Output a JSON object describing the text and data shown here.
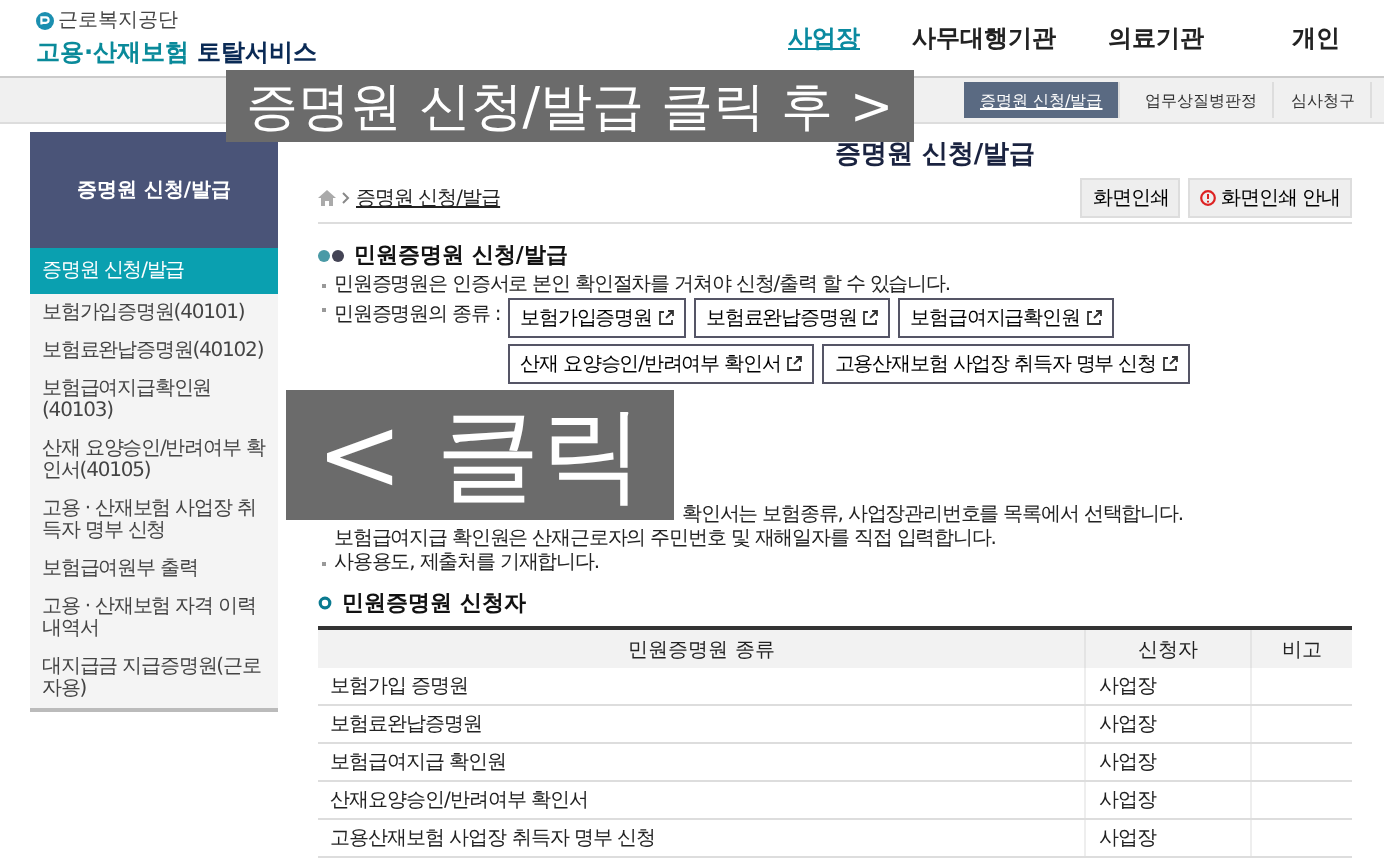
{
  "header": {
    "agency": "근로복지공단",
    "service_prefix": "고용·산재보험",
    "service_suffix": "토탈서비스",
    "nav": [
      {
        "label": "사업장",
        "selected": true
      },
      {
        "label": "사무대행기관",
        "selected": false
      },
      {
        "label": "의료기관",
        "selected": false
      },
      {
        "label": "개인",
        "selected": false
      }
    ]
  },
  "subnav": [
    {
      "label": "증명원 신청/발급",
      "selected": true
    },
    {
      "label": "업무상질병판정",
      "selected": false
    },
    {
      "label": "심사청구",
      "selected": false
    }
  ],
  "sidebar": {
    "title": "증명원 신청/발급",
    "items": [
      {
        "label": "증명원 신청/발급",
        "selected": true
      },
      {
        "label": "보험가입증명원(40101)",
        "selected": false
      },
      {
        "label": "보험료완납증명원(40102)",
        "selected": false
      },
      {
        "label": "보험급여지급확인원(40103)",
        "selected": false
      },
      {
        "label": "산재 요양승인/반려여부 확인서(40105)",
        "selected": false
      },
      {
        "label": "고용 · 산재보험 사업장 취득자 명부 신청",
        "selected": false
      },
      {
        "label": "보험급여원부 출력",
        "selected": false
      },
      {
        "label": "고용 · 산재보험 자격 이력 내역서",
        "selected": false
      },
      {
        "label": "대지급금 지급증명원(근로자용)",
        "selected": false
      }
    ]
  },
  "page_title": "증명원 신청/발급",
  "breadcrumb": "증명원 신청/발급",
  "print_buttons": [
    "화면인쇄",
    "화면인쇄 안내"
  ],
  "section_apply": {
    "title": "민원증명원 신청/발급",
    "notice": "민원증명원은 인증서로 본인 확인절차를 거쳐야 신청/출력 할 수 있습니다.",
    "types_label": "민원증명원의 종류 :",
    "types": [
      "보험가입증명원",
      "보험료완납증명원",
      "보험급여지급확인원",
      "산재 요양승인/반려여부 확인서",
      "고용산재보험 사업장 취득자 명부 신청"
    ]
  },
  "section_steps": {
    "lines": [
      {
        "kind": "partial",
        "text": "확인서는 보험종류, 사업장관리번호를 목록에서 선택합니다."
      },
      {
        "kind": "continuation",
        "text": "보험급여지급 확인원은 산재근로자의 주민번호 및 재해일자를 직접 입력합니다."
      },
      {
        "kind": "item",
        "text": "사용용도, 제출처를 기재합니다."
      }
    ]
  },
  "section_applicant": {
    "title": "민원증명원 신청자",
    "columns": [
      "민원증명원 종류",
      "신청자",
      "비고"
    ],
    "rows": [
      [
        "보험가입 증명원",
        "사업장"
      ],
      [
        "보험료완납증명원",
        "사업장"
      ],
      [
        "보험급여지급 확인원",
        "사업장"
      ],
      [
        "산재요양승인/반려여부 확인서",
        "사업장"
      ],
      [
        "고용산재보험 사업장 취득자 명부 신청",
        "사업장"
      ]
    ]
  },
  "annotations": [
    "증명원 신청/발급 클릭 후 >",
    "< 클릭"
  ]
}
